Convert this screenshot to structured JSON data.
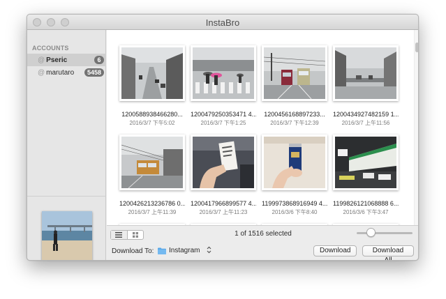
{
  "window": {
    "title": "InstaBro"
  },
  "sidebar": {
    "header": "ACCOUNTS",
    "accounts": [
      {
        "at": "@",
        "name": "Pseric",
        "count": "6",
        "selected": true
      },
      {
        "at": "@",
        "name": "marutaro",
        "count": "5458",
        "selected": false
      }
    ]
  },
  "photos": [
    {
      "caption": "1200588938466280...",
      "date": "2016/3/7 下午5:02",
      "scene": "street"
    },
    {
      "caption": "1200479250353471 4...",
      "date": "2016/3/7 下午1:25",
      "scene": "crosswalk"
    },
    {
      "caption": "1200456168897233...",
      "date": "2016/3/7 下午12:39",
      "scene": "tram"
    },
    {
      "caption": "1200434927482159 1...",
      "date": "2016/3/7 上午11:56",
      "scene": "rainstreet"
    },
    {
      "caption": "1200426213236786 0...",
      "date": "2016/3/7 上午11:39",
      "scene": "tram2"
    },
    {
      "caption": "1200417966899577 4...",
      "date": "2016/3/7 上午11:23",
      "scene": "ticket"
    },
    {
      "caption": "1199973868916949 4...",
      "date": "2016/3/6 下午8:40",
      "scene": "beer"
    },
    {
      "caption": "1199826121068888 6...",
      "date": "2016/3/6 下午3:47",
      "scene": "station"
    }
  ],
  "bottom": {
    "status": "1 of 1516 selected",
    "download_label": "Download To:",
    "folder": "Instagram",
    "stepper": "⌃⌄",
    "download_button": "Download",
    "download_all_button": "Download All",
    "zoom_level": 0.25
  }
}
